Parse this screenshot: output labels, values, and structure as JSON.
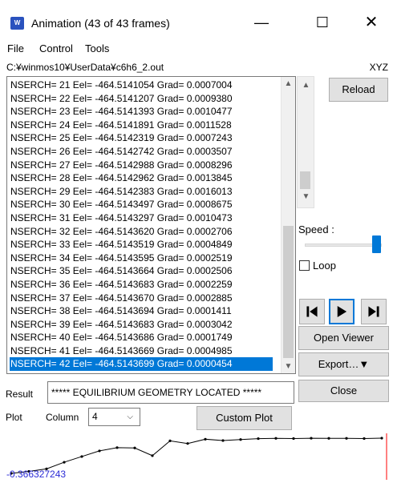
{
  "window": {
    "title": "Animation (43 of 43 frames)",
    "icon": "animation-app-icon",
    "min_glyph": "—",
    "max_glyph": "☐",
    "close_glyph": "✕"
  },
  "menu": {
    "items": [
      {
        "label": "File"
      },
      {
        "label": "Control"
      },
      {
        "label": "Tools"
      }
    ]
  },
  "file": {
    "path": "C:¥winmos10¥UserData¥c6h6_2.out",
    "mode": "XYZ"
  },
  "log": {
    "lines": [
      "NSERCH= 21 Eel= -464.5141054 Grad= 0.0007004",
      "NSERCH= 22 Eel= -464.5141207 Grad= 0.0009380",
      "NSERCH= 23 Eel= -464.5141393 Grad= 0.0010477",
      "NSERCH= 24 Eel= -464.5141891 Grad= 0.0011528",
      "NSERCH= 25 Eel= -464.5142319 Grad= 0.0007243",
      "NSERCH= 26 Eel= -464.5142742 Grad= 0.0003507",
      "NSERCH= 27 Eel= -464.5142988 Grad= 0.0008296",
      "NSERCH= 28 Eel= -464.5142962 Grad= 0.0013845",
      "NSERCH= 29 Eel= -464.5142383 Grad= 0.0016013",
      "NSERCH= 30 Eel= -464.5143497 Grad= 0.0008675",
      "NSERCH= 31 Eel= -464.5143297 Grad= 0.0010473",
      "NSERCH= 32 Eel= -464.5143620 Grad= 0.0002706",
      "NSERCH= 33 Eel= -464.5143519 Grad= 0.0004849",
      "NSERCH= 34 Eel= -464.5143595 Grad= 0.0002519",
      "NSERCH= 35 Eel= -464.5143664 Grad= 0.0002506",
      "NSERCH= 36 Eel= -464.5143683 Grad= 0.0002259",
      "NSERCH= 37 Eel= -464.5143670 Grad= 0.0002885",
      "NSERCH= 38 Eel= -464.5143694 Grad= 0.0001411",
      "NSERCH= 39 Eel= -464.5143683 Grad= 0.0003042",
      "NSERCH= 40 Eel= -464.5143686 Grad= 0.0001749",
      "NSERCH= 41 Eel= -464.5143669 Grad= 0.0004985",
      "NSERCH= 42 Eel= -464.5143699 Grad= 0.0000454"
    ],
    "selected_index": 21
  },
  "controls": {
    "reload_label": "Reload",
    "speed_label": "Speed :",
    "speed_level": 1.0,
    "loop_label": "Loop",
    "loop_checked": false,
    "open_viewer_label": "Open Viewer",
    "export_label": "Export…▼",
    "close_label": "Close"
  },
  "result": {
    "label": "Result",
    "value": "***** EQUILIBRIUM GEOMETRY LOCATED *****"
  },
  "plot": {
    "label": "Plot",
    "column_label": "Column",
    "column_value": "4",
    "custom_plot_label": "Custom Plot",
    "min_label": "-0.366327243",
    "colors": {
      "line": "#000000",
      "marker": "#ff0000",
      "min_text": "#2b2bd6",
      "accent": "#0078d7"
    }
  }
}
